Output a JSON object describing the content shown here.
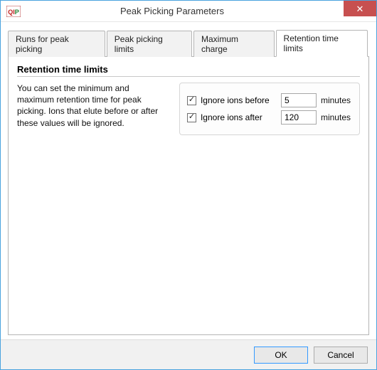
{
  "window": {
    "title": "Peak Picking Parameters",
    "app_icon_label": "QIP",
    "close_glyph": "✕"
  },
  "tabs": [
    {
      "label": "Runs for peak picking",
      "active": false
    },
    {
      "label": "Peak picking limits",
      "active": false
    },
    {
      "label": "Maximum charge",
      "active": false
    },
    {
      "label": "Retention time limits",
      "active": true
    }
  ],
  "panel": {
    "heading": "Retention time limits",
    "description": "You can set the minimum and maximum retention time for peak picking. Ions that elute before or after these values will be ignored.",
    "rows": [
      {
        "checkbox_label": "Ignore ions before",
        "checked": true,
        "value": "5",
        "unit": "minutes"
      },
      {
        "checkbox_label": "Ignore ions after",
        "checked": true,
        "value": "120",
        "unit": "minutes"
      }
    ]
  },
  "footer": {
    "ok": "OK",
    "cancel": "Cancel"
  },
  "colors": {
    "accent": "#4aa3df",
    "close": "#c75050"
  }
}
